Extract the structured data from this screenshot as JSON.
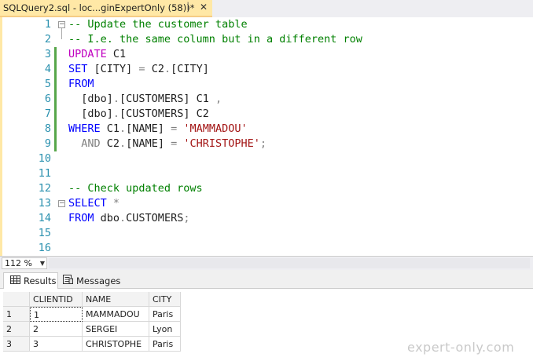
{
  "tab": {
    "title": "SQLQuery2.sql - loc...ginExpertOnly (58))*",
    "pin_icon": "pin-icon",
    "close_icon": "close-icon"
  },
  "editor": {
    "line_numbers": [
      "1",
      "2",
      "3",
      "4",
      "5",
      "6",
      "7",
      "8",
      "9",
      "10",
      "11",
      "12",
      "13",
      "14",
      "15",
      "16"
    ],
    "lines": [
      [
        {
          "t": "-- Update the customer table",
          "c": "cm"
        }
      ],
      [
        {
          "t": "-- I.e. the same column but in a different row",
          "c": "cm"
        }
      ],
      [
        {
          "t": "UPDATE",
          "c": "upd"
        },
        {
          "t": " C1",
          "c": ""
        }
      ],
      [
        {
          "t": "SET",
          "c": "kw"
        },
        {
          "t": " [CITY] ",
          "c": ""
        },
        {
          "t": "=",
          "c": "op"
        },
        {
          "t": " C2",
          "c": ""
        },
        {
          "t": ".",
          "c": "op"
        },
        {
          "t": "[CITY]",
          "c": ""
        }
      ],
      [
        {
          "t": "FROM",
          "c": "kw"
        }
      ],
      [
        {
          "t": "  [dbo]",
          "c": ""
        },
        {
          "t": ".",
          "c": "op"
        },
        {
          "t": "[CUSTOMERS] C1 ",
          "c": ""
        },
        {
          "t": ",",
          "c": "op"
        }
      ],
      [
        {
          "t": "  [dbo]",
          "c": ""
        },
        {
          "t": ".",
          "c": "op"
        },
        {
          "t": "[CUSTOMERS] C2",
          "c": ""
        }
      ],
      [
        {
          "t": "WHERE",
          "c": "kw"
        },
        {
          "t": " C1",
          "c": ""
        },
        {
          "t": ".",
          "c": "op"
        },
        {
          "t": "[NAME] ",
          "c": ""
        },
        {
          "t": "=",
          "c": "op"
        },
        {
          "t": " ",
          "c": ""
        },
        {
          "t": "'MAMMADOU'",
          "c": "str"
        }
      ],
      [
        {
          "t": "  ",
          "c": ""
        },
        {
          "t": "AND",
          "c": "op"
        },
        {
          "t": " C2",
          "c": ""
        },
        {
          "t": ".",
          "c": "op"
        },
        {
          "t": "[NAME] ",
          "c": ""
        },
        {
          "t": "=",
          "c": "op"
        },
        {
          "t": " ",
          "c": ""
        },
        {
          "t": "'CHRISTOPHE'",
          "c": "str"
        },
        {
          "t": ";",
          "c": "op"
        }
      ],
      [],
      [],
      [
        {
          "t": "-- Check updated rows",
          "c": "cm"
        }
      ],
      [
        {
          "t": "SELECT",
          "c": "kw"
        },
        {
          "t": " ",
          "c": ""
        },
        {
          "t": "*",
          "c": "op"
        }
      ],
      [
        {
          "t": "FROM",
          "c": "kw"
        },
        {
          "t": " dbo",
          "c": ""
        },
        {
          "t": ".",
          "c": "op"
        },
        {
          "t": "CUSTOMERS",
          "c": ""
        },
        {
          "t": ";",
          "c": "op"
        }
      ],
      [],
      []
    ]
  },
  "zoom": {
    "value": "112 %"
  },
  "results_tabs": [
    {
      "label": "Results",
      "icon": "grid-icon",
      "active": true
    },
    {
      "label": "Messages",
      "icon": "messages-icon",
      "active": false
    }
  ],
  "grid": {
    "columns": [
      "CLIENTID",
      "NAME",
      "CITY"
    ],
    "rows": [
      {
        "num": "1",
        "cells": [
          "1",
          "MAMMADOU",
          "Paris"
        ]
      },
      {
        "num": "2",
        "cells": [
          "2",
          "SERGEI",
          "Lyon"
        ]
      },
      {
        "num": "3",
        "cells": [
          "3",
          "CHRISTOPHE",
          "Paris"
        ]
      }
    ]
  },
  "watermark": "expert-only.com"
}
